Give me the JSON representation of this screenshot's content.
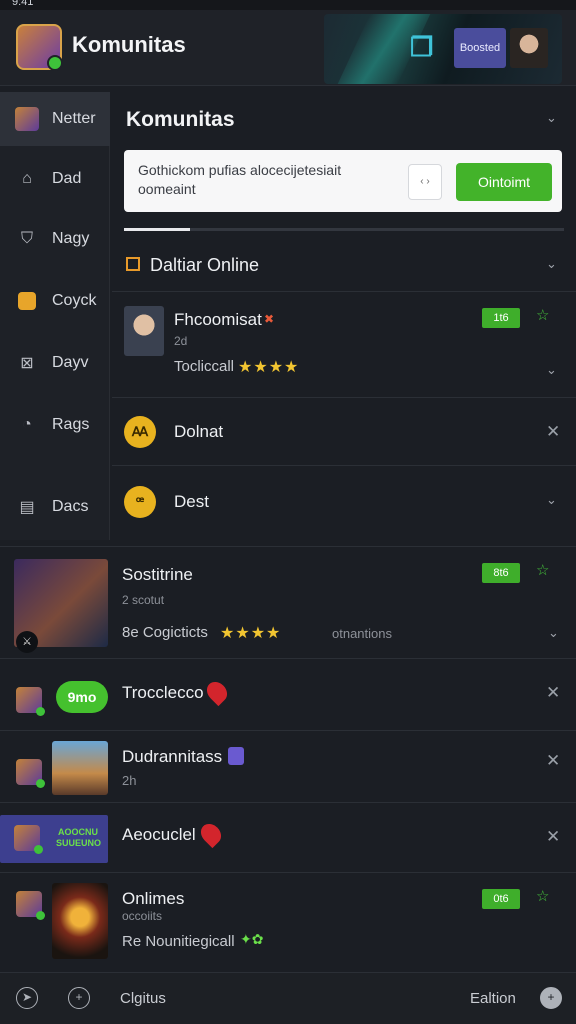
{
  "statusbar": {
    "time": "9:41"
  },
  "header": {
    "title": "Komunitas",
    "banner_badge": "Boosted"
  },
  "sidebar": {
    "items": [
      {
        "label": "Netter",
        "icon": "game-logo-icon"
      },
      {
        "label": "Dad",
        "icon": "home-icon"
      },
      {
        "label": "Nagy",
        "icon": "shield-icon"
      },
      {
        "label": "Coyck",
        "icon": "chat-bubble-icon"
      },
      {
        "label": "Dayv",
        "icon": "inbox-icon"
      },
      {
        "label": "Rags",
        "icon": "compass-icon"
      },
      {
        "label": "Dacs",
        "icon": "document-icon"
      }
    ]
  },
  "main": {
    "title": "Komunitas",
    "search": {
      "text": "Gothickom pufias alocecijetesiait oomeaint",
      "small_button": "‹ ›",
      "button": "Ointoimt"
    },
    "section": {
      "title": "Daltiar Online"
    },
    "entry1": {
      "title": "Fhcoomisat",
      "sub": "2d",
      "meta": "Tocliccall",
      "pill": "1t6",
      "stars": "★★★★"
    },
    "entry2": {
      "title": "Dolnat",
      "icon": "Ꜳ"
    },
    "entry3": {
      "title": "Dest",
      "icon": "ꟹ"
    }
  },
  "feed": [
    {
      "title": "Sostitrine",
      "sub": "2 scotut",
      "meta": "8e Cogicticts",
      "meta2": "otnantions",
      "pill": "8t6",
      "stars": "★★★★"
    },
    {
      "title": "Trocclecco",
      "pill": "9mo"
    },
    {
      "title": "Dudrannitass",
      "sub": "2h"
    },
    {
      "title": "Aeocuclel",
      "badge_top": "AOOCNU",
      "badge_bottom": "SUUEUNO"
    },
    {
      "title": "Onlimes",
      "sub": "occoiits",
      "meta": "Re Nounitiegicall",
      "pill": "0t6"
    }
  ],
  "bottombar": {
    "left_label": "Clgitus",
    "right_label": "Ealtion"
  }
}
